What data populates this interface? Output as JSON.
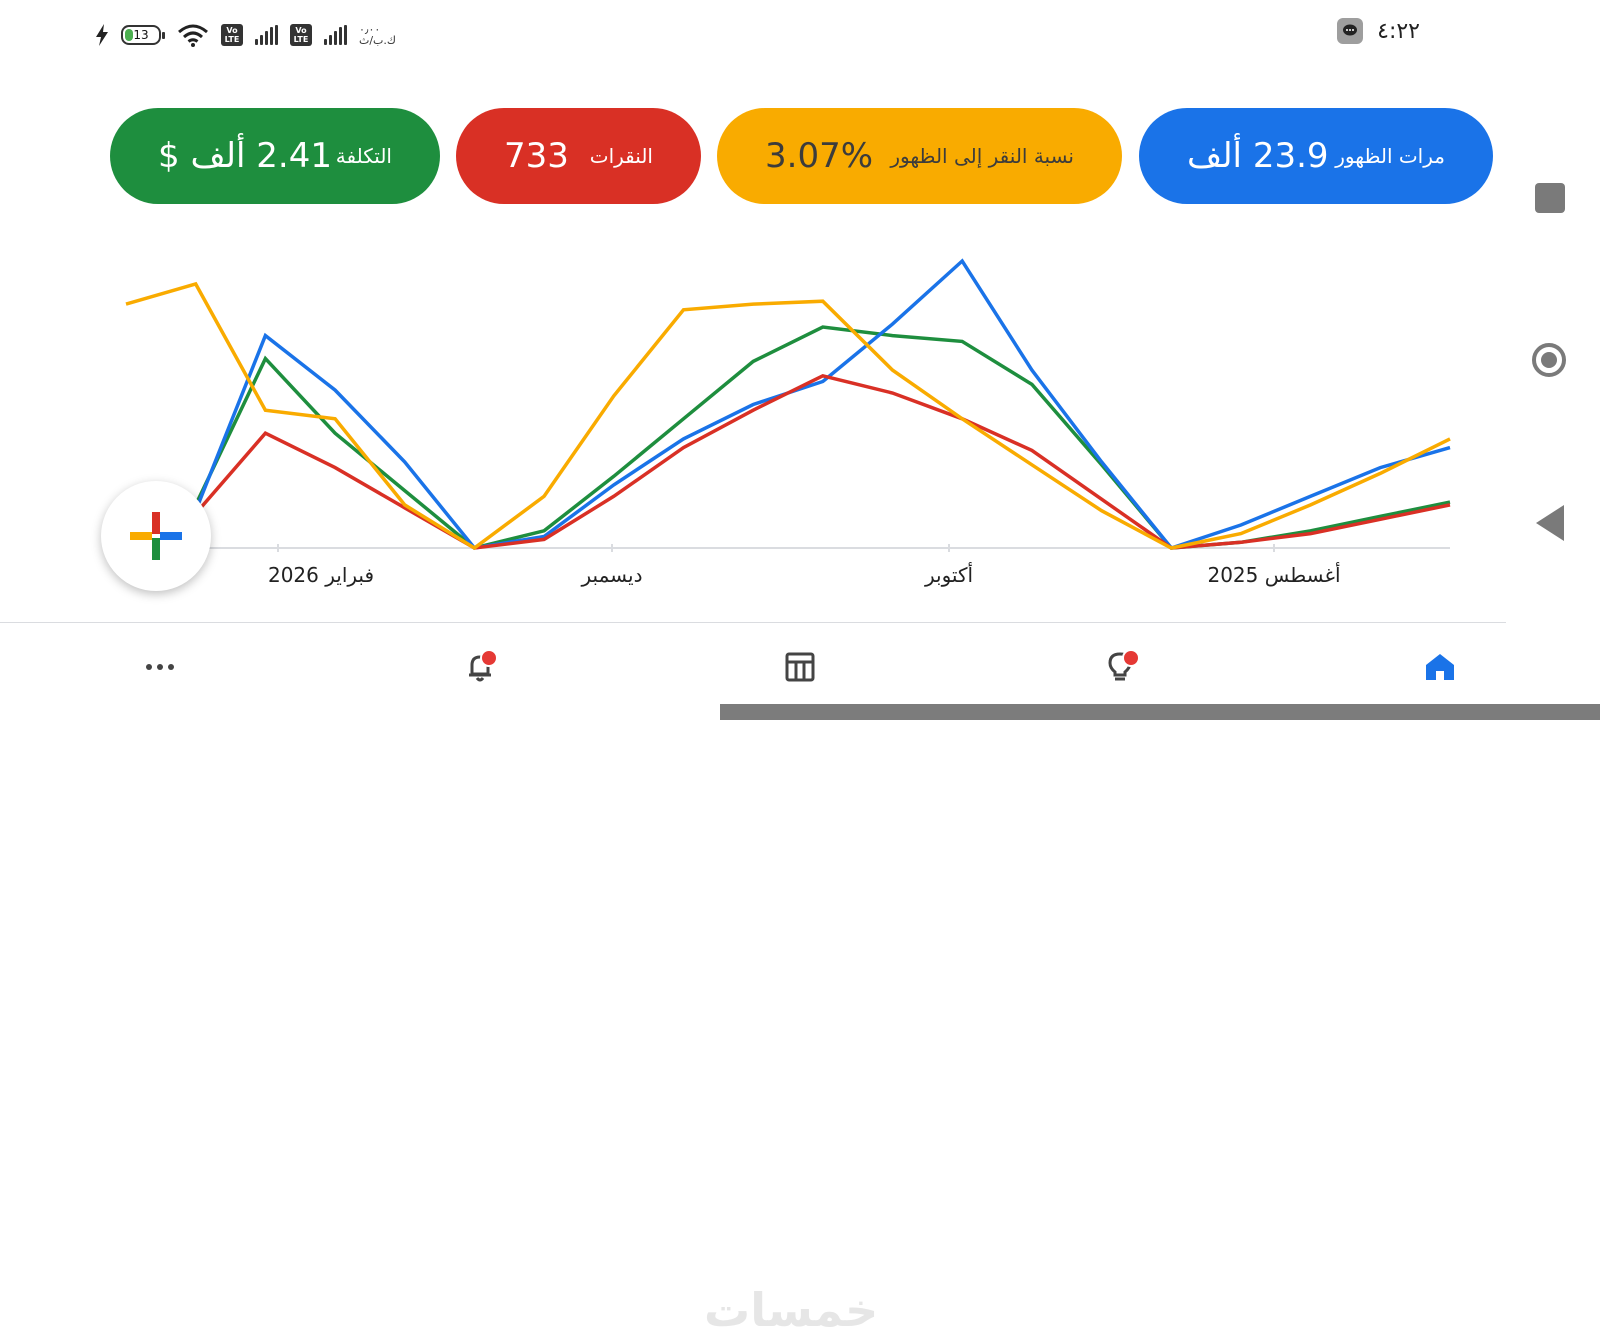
{
  "status_bar": {
    "battery_level": "13",
    "network_speed": "٠٫٠٠\nك.ب/ث",
    "volte_label_top": "Vo",
    "volte_label_bottom": "LTE",
    "time": "٤:٢٢"
  },
  "metrics": [
    {
      "label": "مرات الظهور",
      "value": "23.9 ألف",
      "color": "#1a73e8"
    },
    {
      "label": "نسبة النقر إلى الظهور",
      "value": "3.07%",
      "color": "#f9ab00"
    },
    {
      "label": "النقرات",
      "value": "733",
      "color": "#d93025"
    },
    {
      "label": "التكلفة",
      "value": "2.41 ألف $",
      "color": "#1e8e3e"
    }
  ],
  "chart_data": {
    "type": "line",
    "x": [
      "2025-08-04",
      "2025-08-14",
      "2025-08-24",
      "2025-09-03",
      "2025-09-13",
      "2025-09-23",
      "2025-10-03",
      "2025-10-13",
      "2025-10-23",
      "2025-11-02",
      "2025-11-12",
      "2025-11-22",
      "2025-12-02",
      "2025-12-12",
      "2025-12-22",
      "2026-01-01",
      "2026-01-11",
      "2026-01-21",
      "2026-01-31",
      "2026-02-10"
    ],
    "x_axis_labels": [
      "أغسطس 2025",
      "أكتوبر",
      "ديسمبر",
      "فبراير 2026"
    ],
    "direction": "rtl",
    "grid": false,
    "legend": "none",
    "series": [
      {
        "color": "#1a73e8",
        "values": [
          0.35,
          0.28,
          0.18,
          0.08,
          0.0,
          0.3,
          0.62,
          1.0,
          0.78,
          0.58,
          0.5,
          0.38,
          0.22,
          0.04,
          0.0,
          0.3,
          0.55,
          0.74,
          0.13,
          0.1
        ]
      },
      {
        "color": "#d93025",
        "values": [
          0.15,
          0.1,
          0.05,
          0.02,
          0.0,
          0.17,
          0.34,
          0.45,
          0.54,
          0.6,
          0.48,
          0.35,
          0.18,
          0.03,
          0.0,
          0.14,
          0.28,
          0.4,
          0.12,
          0.09
        ]
      },
      {
        "color": "#1e8e3e",
        "values": [
          0.16,
          0.11,
          0.06,
          0.02,
          0.0,
          0.29,
          0.57,
          0.72,
          0.74,
          0.77,
          0.65,
          0.45,
          0.25,
          0.06,
          0.0,
          0.2,
          0.4,
          0.66,
          0.15,
          0.17
        ]
      },
      {
        "color": "#f9ab00",
        "values": [
          0.38,
          0.26,
          0.15,
          0.05,
          0.0,
          0.13,
          0.29,
          0.45,
          0.62,
          0.86,
          0.85,
          0.83,
          0.53,
          0.18,
          0.0,
          0.15,
          0.45,
          0.48,
          0.92,
          0.85
        ]
      }
    ]
  },
  "bottom_nav": {
    "items": [
      {
        "name": "home",
        "color": "#1a73e8"
      },
      {
        "name": "recommendations",
        "badge": true
      },
      {
        "name": "table-view"
      },
      {
        "name": "notifications",
        "badge": true
      },
      {
        "name": "more"
      }
    ],
    "watermark": "خمسات"
  }
}
